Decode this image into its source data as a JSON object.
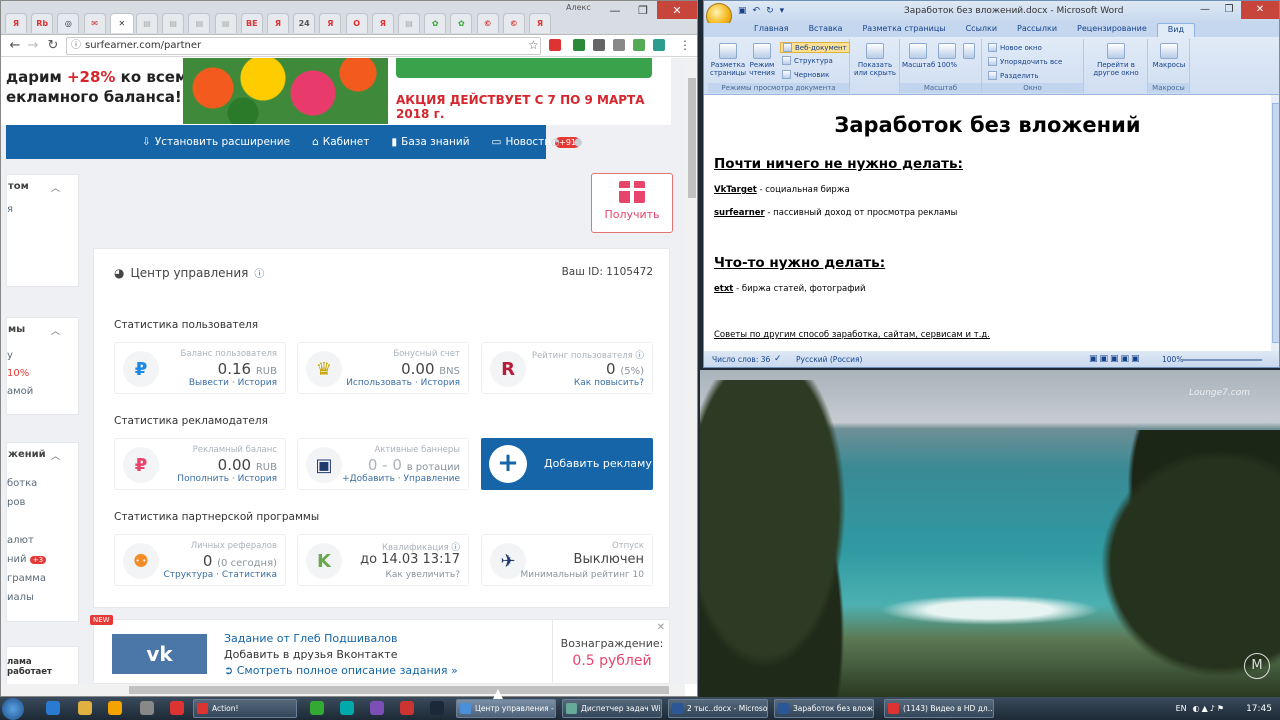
{
  "browser": {
    "url": "surfearner.com/partner",
    "tab_icons": [
      {
        "icon": "yandex",
        "color": "#f4f4f4",
        "glyph": "Я",
        "fg": "#d33"
      },
      {
        "icon": "rambler",
        "color": "#f4f4f4",
        "glyph": "Rb",
        "fg": "#d33"
      },
      {
        "icon": "steam",
        "color": "#f4f4f4",
        "glyph": "◎",
        "fg": "#1b2838"
      },
      {
        "icon": "gmail",
        "color": "#f4f4f4",
        "glyph": "✉",
        "fg": "#c33"
      },
      {
        "icon": "active",
        "color": "#fff",
        "glyph": "",
        "fg": "#333"
      },
      {
        "icon": "doc",
        "color": "#f4f4f4",
        "glyph": "▤",
        "fg": "#aaa"
      },
      {
        "icon": "doc",
        "color": "#f4f4f4",
        "glyph": "▤",
        "fg": "#aaa"
      },
      {
        "icon": "doc",
        "color": "#f4f4f4",
        "glyph": "▤",
        "fg": "#aaa"
      },
      {
        "icon": "doc",
        "color": "#f4f4f4",
        "glyph": "▤",
        "fg": "#aaa"
      },
      {
        "icon": "be",
        "color": "#f4f4f4",
        "glyph": "BE",
        "fg": "#d33"
      },
      {
        "icon": "yandex",
        "color": "#f4f4f4",
        "glyph": "Я",
        "fg": "#d33"
      },
      {
        "icon": "24",
        "color": "#f4f4f4",
        "glyph": "24",
        "fg": "#555"
      },
      {
        "icon": "yandex",
        "color": "#f4f4f4",
        "glyph": "Я",
        "fg": "#d33"
      },
      {
        "icon": "opera",
        "color": "#f4f4f4",
        "glyph": "O",
        "fg": "#d33"
      },
      {
        "icon": "yandex",
        "color": "#f4f4f4",
        "glyph": "Я",
        "fg": "#d33"
      },
      {
        "icon": "doc",
        "color": "#f4f4f4",
        "glyph": "▤",
        "fg": "#aaa"
      },
      {
        "icon": "palm",
        "color": "#f4f4f4",
        "glyph": "✿",
        "fg": "#3a3"
      },
      {
        "icon": "palm",
        "color": "#f4f4f4",
        "glyph": "✿",
        "fg": "#3a3"
      },
      {
        "icon": "c",
        "color": "#f4f4f4",
        "glyph": "©",
        "fg": "#d33"
      },
      {
        "icon": "c",
        "color": "#f4f4f4",
        "glyph": "©",
        "fg": "#d33"
      },
      {
        "icon": "yandex",
        "color": "#f4f4f4",
        "glyph": "Я",
        "fg": "#d33"
      }
    ],
    "window_user": "Алекс"
  },
  "banner": {
    "line1_prefix": "дарим ",
    "line1_accent": "+28%",
    "line1_suffix": " ко всем",
    "line2": "екламного баланса!",
    "promo": "АКЦИЯ ДЕЙСТВУЕТ С 7 ПО 9 МАРТА 2018 г."
  },
  "nav": {
    "install": "Установить расширение",
    "cabinet": "Кабинет",
    "kb": "База знаний",
    "news": "Новости",
    "news_badge": "+91"
  },
  "left": {
    "h1": "том",
    "i1": "я",
    "h2": "мы",
    "i2": "у",
    "i3": "10%",
    "i4": "амой",
    "h3": "жений",
    "i5": "ботка",
    "i6": "ров",
    "i7": "алют",
    "i8": "ний",
    "i8_badge": "+3",
    "i9": "грамма",
    "i10": "иалы",
    "bottom": "лама работает"
  },
  "get_button": "Получить",
  "panel": {
    "title": "Центр управления",
    "user_id": "Ваш ID: 1105472",
    "sec_user": "Статистика пользователя",
    "sec_adv": "Статистика рекламодателя",
    "sec_partner": "Статистика партнерской программы",
    "stats": {
      "balance": {
        "cap": "Баланс пользователя",
        "val": "0.16",
        "unit": "RUB",
        "link1": "Вывести",
        "link2": "История"
      },
      "bonus": {
        "cap": "Бонусный счет",
        "val": "0.00",
        "unit": "BNS",
        "link1": "Использовать",
        "link2": "История"
      },
      "rating": {
        "cap": "Рейтинг пользователя",
        "val": "0",
        "unit": "(5%)",
        "link1": "Как повысить?"
      },
      "adbal": {
        "cap": "Рекламный баланс",
        "val": "0.00",
        "unit": "RUB",
        "link1": "Пополнить",
        "link2": "История"
      },
      "banners": {
        "cap": "Активные баннеры",
        "val": "0 - 0",
        "unit": "в ротации",
        "link1": "+Добавить",
        "link2": "Управление"
      },
      "refs": {
        "cap": "Личных рефералов",
        "val": "0",
        "unit": "(0 сегодня)",
        "link1": "Структура",
        "link2": "Статистика"
      },
      "qual": {
        "cap": "Квалификация",
        "val": "до 14.03 13:17",
        "link1": "Как увеличить?"
      },
      "vac": {
        "cap": "Отпуск",
        "val": "Выключен",
        "link1": "Минимальный рейтинг 10"
      }
    },
    "add_ad": "Добавить рекламу"
  },
  "task": {
    "new": "NEW",
    "from": "Задание от Глеб Подшивалов",
    "desc": "Добавить в друзья Вконтакте",
    "more": "Смотреть полное описание задания »",
    "reward_label": "Вознаграждение:",
    "reward": "0.5 рублей"
  },
  "word": {
    "title": "Заработок без вложений.docx - Microsoft Word",
    "tabs": [
      "Главная",
      "Вставка",
      "Разметка страницы",
      "Ссылки",
      "Рассылки",
      "Рецензирование",
      "Вид"
    ],
    "ribbon": {
      "layout": "Разметка страницы",
      "reading": "Режим чтения",
      "web": "Веб-документ",
      "outline": "Структура",
      "draft": "Черновик",
      "views_group": "Режимы просмотра документа",
      "show": "Показать или скрыть",
      "zoom": "Масштаб",
      "zoom100": "100%",
      "zoom_group": "Масштаб",
      "newwin": "Новое окно",
      "arrange": "Упорядочить все",
      "split": "Разделить",
      "switch": "Перейти в другое окно",
      "window_group": "Окно",
      "macros": "Макросы",
      "macros_group": "Макросы"
    },
    "doc": {
      "title": "Заработок без вложений",
      "h1": "Почти ничего не нужно делать:",
      "l1_name": "VkTarget",
      "l1_text": " - социальная биржа",
      "l2_name": "surfearner",
      "l2_text": " - пассивный доход от просмотра рекламы",
      "h2": "Что-то нужно делать:",
      "l3_name": "etxt",
      "l3_text": " - биржа статей, фотографий",
      "l4": "Советы по другим способ заработка, сайтам, сервисам и т.д."
    },
    "status": {
      "words": "Число слов: 36",
      "lang": "Русский (Россия)",
      "zoom": "100%"
    }
  },
  "desktop": {
    "watermark": "Lounge7.com",
    "corner": "M"
  },
  "taskbar": {
    "items": [
      {
        "label": "Action!",
        "color": "#d33"
      },
      {
        "label": "Центр управления - ...",
        "color": "#4a90d9"
      },
      {
        "label": "Диспетчер задач Wi...",
        "color": "#6a9"
      },
      {
        "label": "2 тыс..docx - Microsof...",
        "color": "#2b5797"
      },
      {
        "label": "Заработок без влож...",
        "color": "#2b5797"
      },
      {
        "label": "(1143) Видео в HD дл...",
        "color": "#d33"
      }
    ],
    "lang": "EN",
    "time": "17:45"
  }
}
